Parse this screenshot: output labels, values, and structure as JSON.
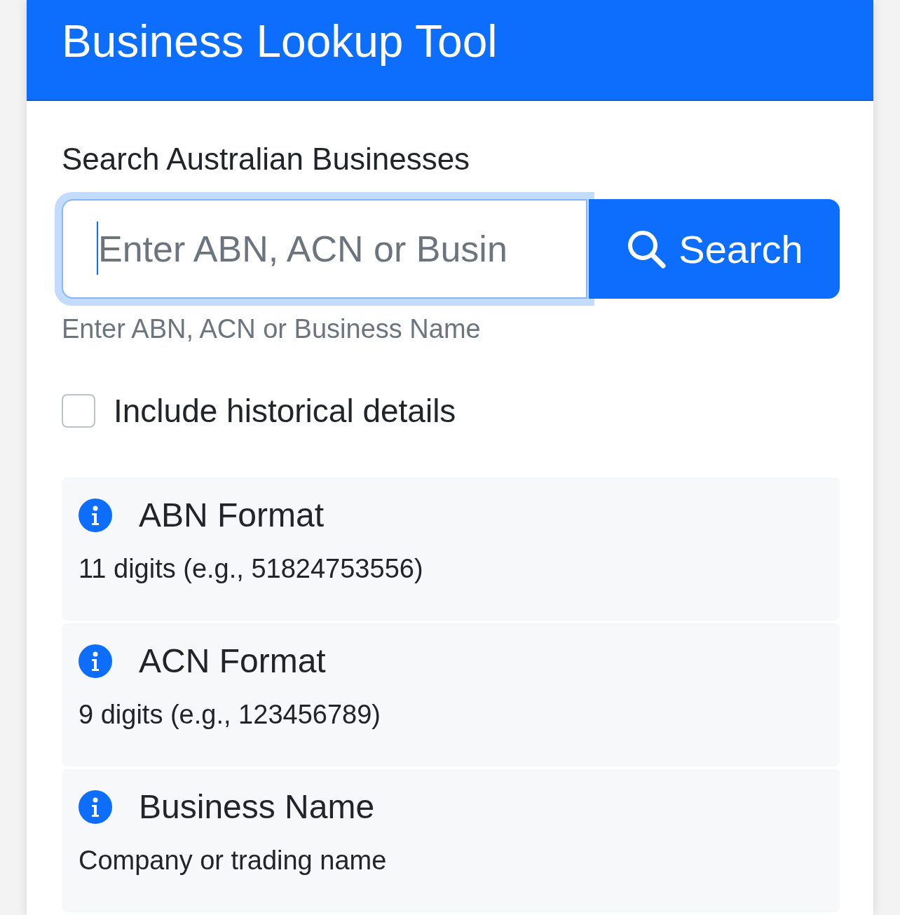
{
  "header": {
    "title": "Business Lookup Tool"
  },
  "search": {
    "label": "Search Australian Businesses",
    "placeholder": "Enter ABN, ACN or Busin",
    "focused": true,
    "button": "Search",
    "help": "Enter ABN, ACN or Business Name"
  },
  "options": [
    {
      "label": "Include historical details",
      "checked": false
    }
  ],
  "info_cards": [
    {
      "title": "ABN Format",
      "text": "11 digits (e.g., 51824753556)"
    },
    {
      "title": "ACN Format",
      "text": "9 digits (e.g., 123456789)"
    },
    {
      "title": "Business Name",
      "text": "Company or trading name"
    }
  ]
}
